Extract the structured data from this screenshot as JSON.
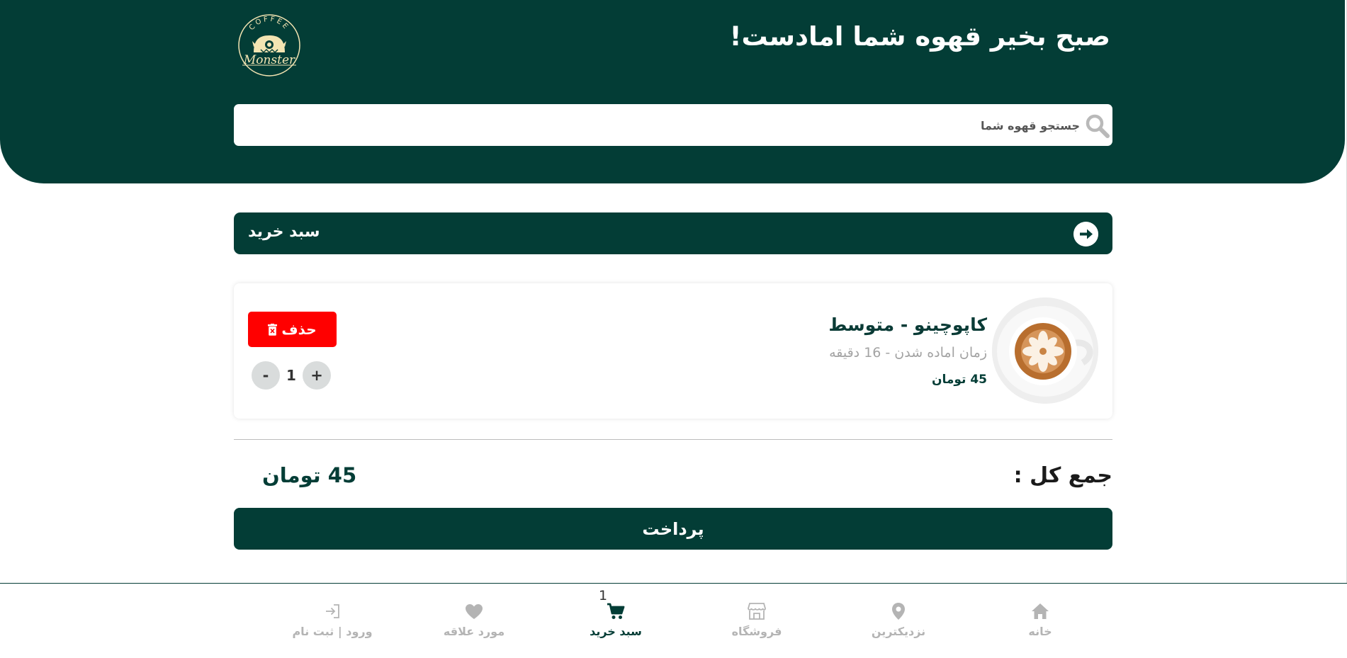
{
  "header": {
    "greeting": "صبح بخیر قهوه شما امادست!",
    "logo_text_top": "COFFEE",
    "logo_text_main": "Monster"
  },
  "search": {
    "placeholder": "جستجو قهوه شما",
    "value": ""
  },
  "cart_bar": {
    "title": "سبد خرید",
    "back_icon": "arrow-right-circle-icon"
  },
  "cart": {
    "items": [
      {
        "name": "کاپوچینو - متوسط",
        "prep_time": "زمان اماده شدن - 16 دقیقه",
        "price": "45 تومان",
        "delete_label": "حذف",
        "quantity": "1",
        "plus_label": "+",
        "minus_label": "-"
      }
    ],
    "total_label": "جمع کل :",
    "total_value": "45 تومان",
    "pay_label": "پرداخت"
  },
  "bottom_nav": {
    "cart_count": "1",
    "items": [
      {
        "label": "خانه",
        "icon": "home-icon"
      },
      {
        "label": "نزدیکترین",
        "icon": "location-pin-icon"
      },
      {
        "label": "فروشگاه",
        "icon": "store-icon"
      },
      {
        "label": "سبد خرید",
        "icon": "cart-icon"
      },
      {
        "label": "مورد علاقه",
        "icon": "heart-icon"
      },
      {
        "label": "ورود | ثبت نام",
        "icon": "login-icon"
      }
    ]
  },
  "colors": {
    "primary": "#033d36",
    "danger": "#ff0000",
    "muted": "#b4b4b4",
    "logo_accent": "#f3e4b2"
  }
}
